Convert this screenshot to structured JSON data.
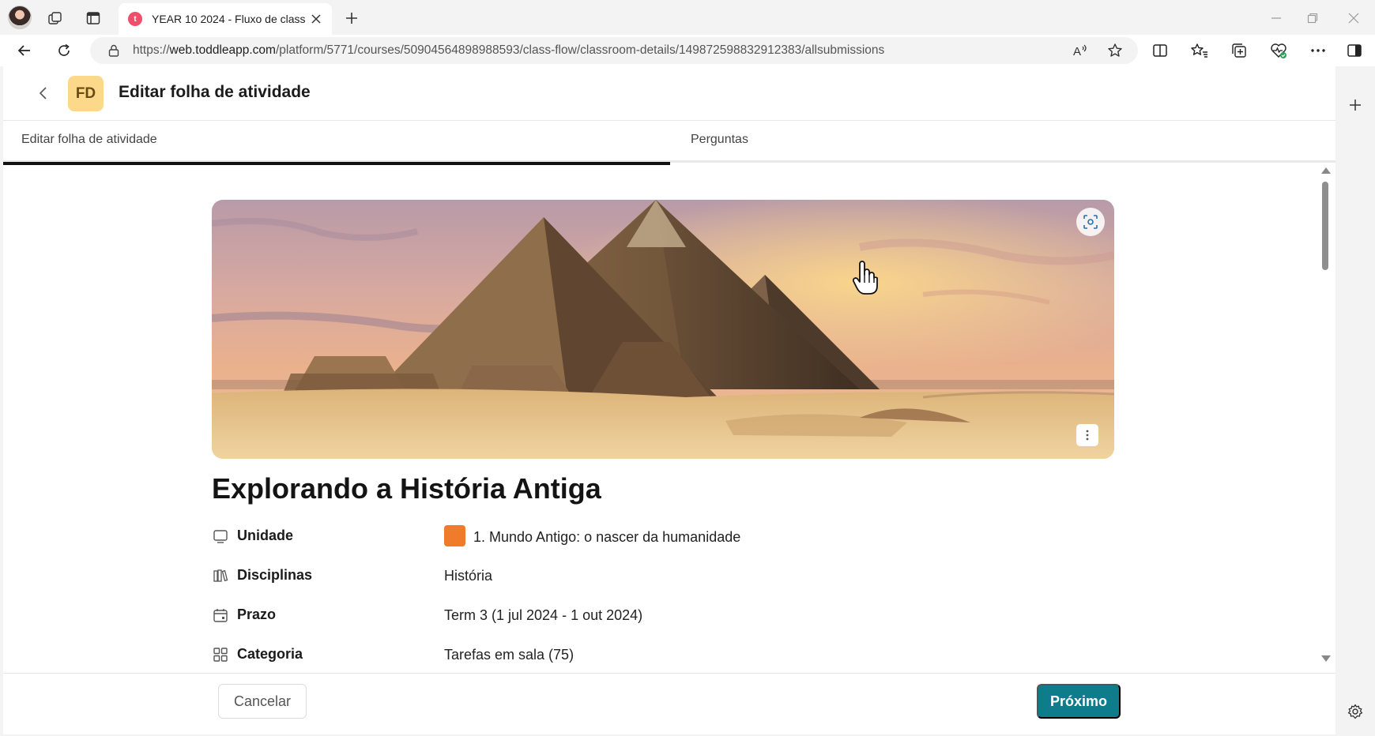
{
  "browser": {
    "tab_title": "YEAR 10 2024 - Fluxo de classe",
    "tab_favicon_letter": "t",
    "url_prefix": "https://",
    "url_domain": "web.toddleapp.com",
    "url_path": "/platform/5771/courses/50904564898988593/class-flow/classroom-details/149872598832912383/allsubmissions",
    "icons": [
      "profile-avatar",
      "workspaces-icon",
      "tab-actions-icon",
      "close-icon",
      "plus-icon",
      "minimize-icon",
      "restore-icon",
      "back-icon",
      "refresh-icon",
      "lock-icon",
      "read-aloud-icon",
      "favorite-star-icon",
      "split-screen-icon",
      "favorites-icon",
      "collections-icon",
      "browser-essentials-icon",
      "more-icon",
      "sidebar-toggle-icon",
      "settings-gear-icon"
    ]
  },
  "header": {
    "badge": "FD",
    "title": "Editar folha de atividade"
  },
  "tabs": [
    {
      "label": "Editar folha de atividade",
      "active": true
    },
    {
      "label": "Perguntas",
      "active": false
    }
  ],
  "activity": {
    "title": "Explorando a História Antiga",
    "details": [
      {
        "icon": "unit-icon",
        "label": "Unidade",
        "value": "1. Mundo Antigo: o nascer da humanidade",
        "swatch": "#f07b2b"
      },
      {
        "icon": "book-icon",
        "label": "Disciplinas",
        "value": "História"
      },
      {
        "icon": "calendar-icon",
        "label": "Prazo",
        "value": "Term 3 (1 jul 2024 - 1 out 2024)"
      },
      {
        "icon": "grid-icon",
        "label": "Categoria",
        "value": "Tarefas em sala (75)"
      }
    ]
  },
  "footer": {
    "cancel_label": "Cancelar",
    "next_label": "Próximo"
  },
  "colors": {
    "accent": "#0f7c8c",
    "badge_bg": "#fbd88a",
    "unit_swatch": "#f07b2b"
  }
}
